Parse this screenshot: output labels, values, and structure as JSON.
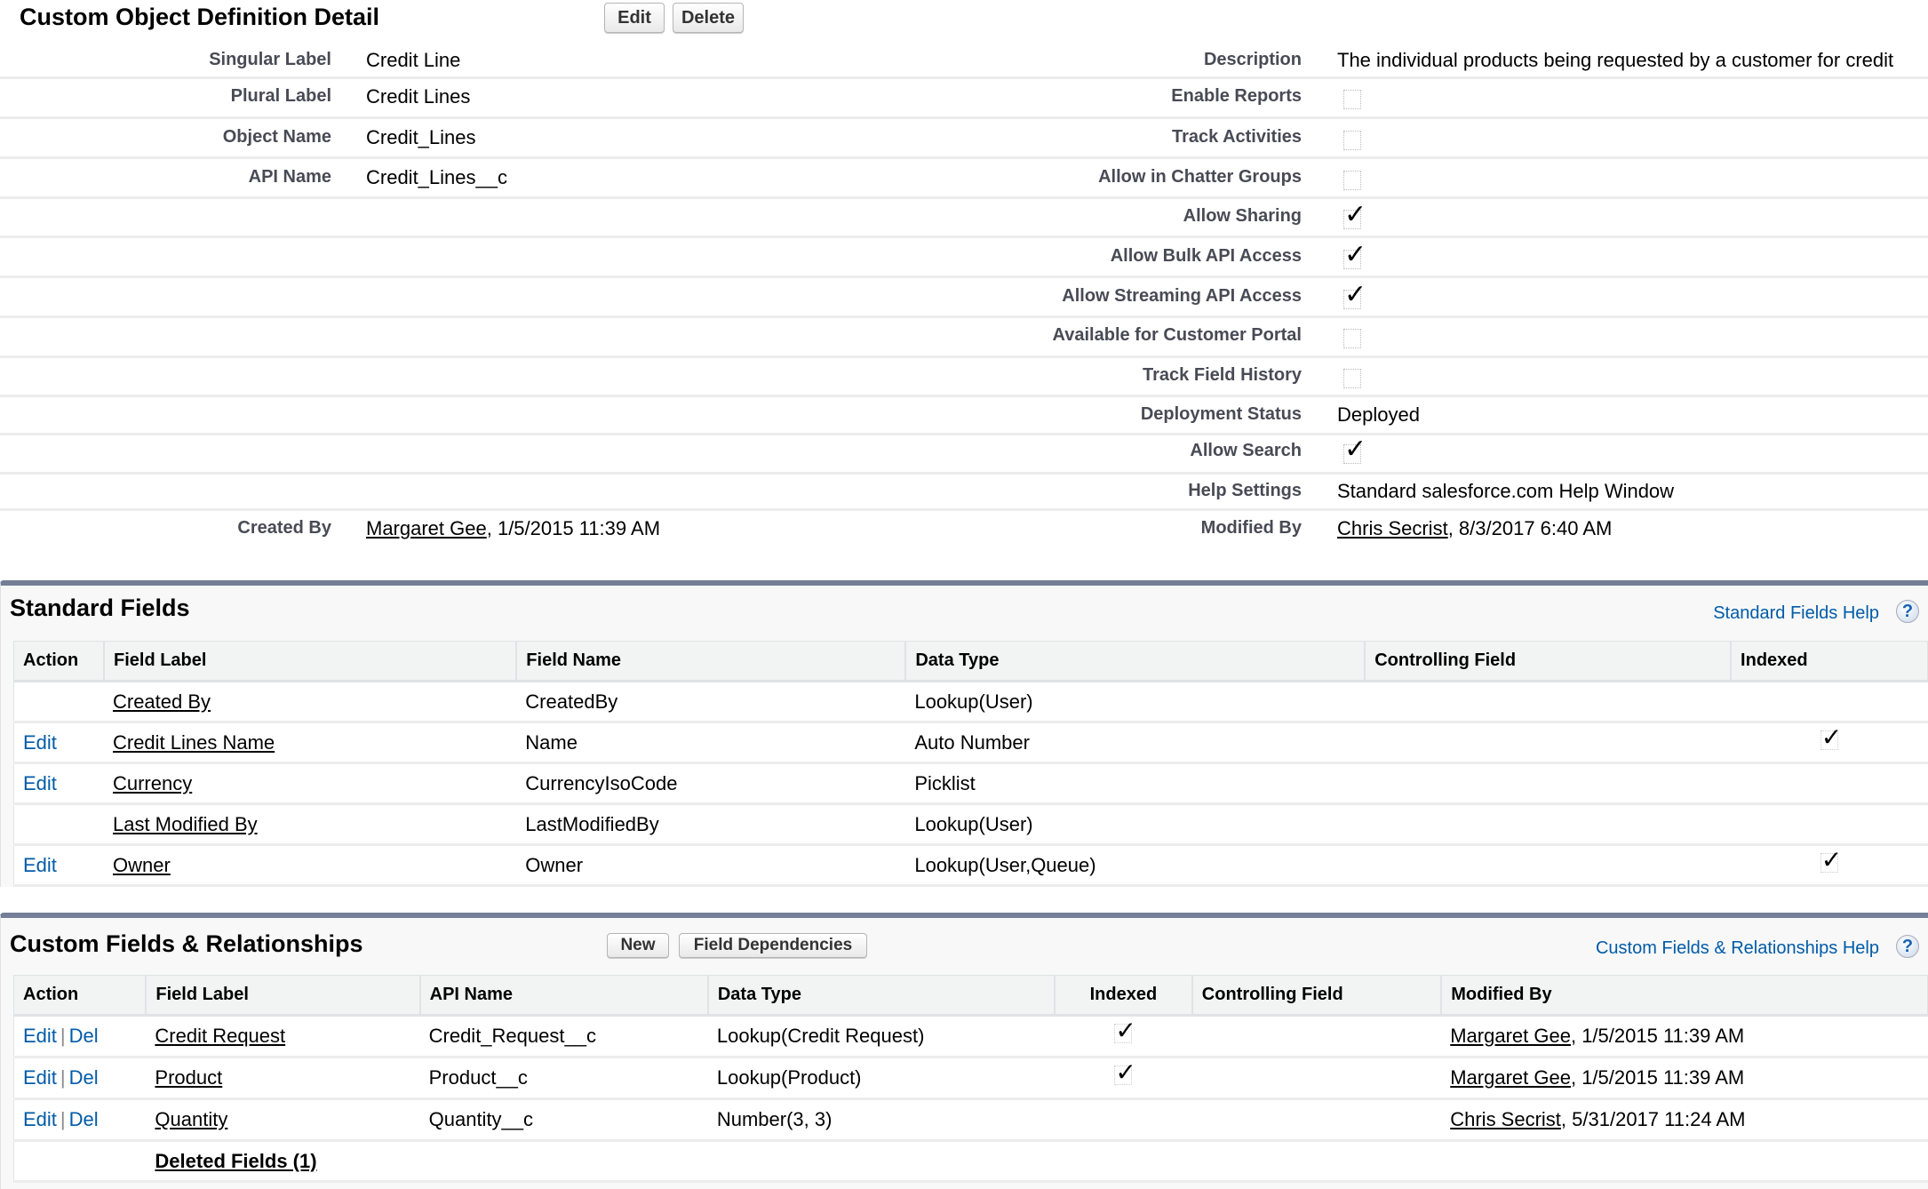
{
  "header": {
    "title": "Custom Object Definition Detail",
    "edit_label": "Edit",
    "delete_label": "Delete"
  },
  "detail": {
    "left": [
      {
        "label": "Singular Label",
        "value": "Credit Line"
      },
      {
        "label": "Plural Label",
        "value": "Credit Lines"
      },
      {
        "label": "Object Name",
        "value": "Credit_Lines"
      },
      {
        "label": "API Name",
        "value": "Credit_Lines__c"
      }
    ],
    "right": [
      {
        "label": "Description",
        "type": "text",
        "value": "The individual products being requested by a customer for credit"
      },
      {
        "label": "Enable Reports",
        "type": "checkbox",
        "checked": false
      },
      {
        "label": "Track Activities",
        "type": "checkbox",
        "checked": false
      },
      {
        "label": "Allow in Chatter Groups",
        "type": "checkbox",
        "checked": false
      },
      {
        "label": "Allow Sharing",
        "type": "checkbox",
        "checked": true
      },
      {
        "label": "Allow Bulk API Access",
        "type": "checkbox",
        "checked": true
      },
      {
        "label": "Allow Streaming API Access",
        "type": "checkbox",
        "checked": true
      },
      {
        "label": "Available for Customer Portal",
        "type": "checkbox",
        "checked": false
      },
      {
        "label": "Track Field History",
        "type": "checkbox",
        "checked": false
      },
      {
        "label": "Deployment Status",
        "type": "text",
        "value": "Deployed"
      },
      {
        "label": "Allow Search",
        "type": "checkbox",
        "checked": true
      },
      {
        "label": "Help Settings",
        "type": "text",
        "value": "Standard salesforce.com Help Window"
      }
    ],
    "created_by": {
      "label": "Created By",
      "user": "Margaret Gee",
      "date": ", 1/5/2015 11:39 AM"
    },
    "modified_by": {
      "label": "Modified By",
      "user": "Chris Secrist",
      "date": ", 8/3/2017 6:40 AM"
    }
  },
  "icons": {
    "check": "✓",
    "help": "?"
  },
  "standard_fields": {
    "title": "Standard Fields",
    "help_label": "Standard Fields Help",
    "columns": [
      "Action",
      "Field Label",
      "Field Name",
      "Data Type",
      "Controlling Field",
      "Indexed"
    ],
    "rows": [
      {
        "action": "",
        "label": "Created By",
        "name": "CreatedBy",
        "type": "Lookup(User)",
        "controlling": "",
        "indexed": false
      },
      {
        "action": "Edit",
        "label": "Credit Lines Name",
        "name": "Name",
        "type": "Auto Number",
        "controlling": "",
        "indexed": true
      },
      {
        "action": "Edit",
        "label": "Currency",
        "name": "CurrencyIsoCode",
        "type": "Picklist",
        "controlling": "",
        "indexed": false
      },
      {
        "action": "",
        "label": "Last Modified By",
        "name": "LastModifiedBy",
        "type": "Lookup(User)",
        "controlling": "",
        "indexed": false
      },
      {
        "action": "Edit",
        "label": "Owner",
        "name": "Owner",
        "type": "Lookup(User,Queue)",
        "controlling": "",
        "indexed": true
      }
    ]
  },
  "custom_fields": {
    "title": "Custom Fields & Relationships",
    "new_label": "New",
    "dependencies_label": "Field Dependencies",
    "help_label": "Custom Fields & Relationships Help",
    "columns": [
      "Action",
      "Field Label",
      "API Name",
      "Data Type",
      "Indexed",
      "Controlling Field",
      "Modified By"
    ],
    "edit_label": "Edit",
    "del_label": "Del",
    "separator": "|",
    "rows": [
      {
        "label": "Credit Request",
        "api": "Credit_Request__c",
        "type": "Lookup(Credit Request)",
        "indexed": true,
        "controlling": "",
        "modified_user": "Margaret Gee",
        "modified_date": ", 1/5/2015 11:39 AM"
      },
      {
        "label": "Product",
        "api": "Product__c",
        "type": "Lookup(Product)",
        "indexed": true,
        "controlling": "",
        "modified_user": "Margaret Gee",
        "modified_date": ", 1/5/2015 11:39 AM"
      },
      {
        "label": "Quantity",
        "api": "Quantity__c",
        "type": "Number(3, 3)",
        "indexed": false,
        "controlling": "",
        "modified_user": "Chris Secrist",
        "modified_date": ", 5/31/2017 11:24 AM"
      }
    ],
    "deleted_label": "Deleted Fields (1)"
  },
  "colors": {
    "link": "#015ba7",
    "section_bar": "#747e96",
    "label": "#4a4a56"
  }
}
